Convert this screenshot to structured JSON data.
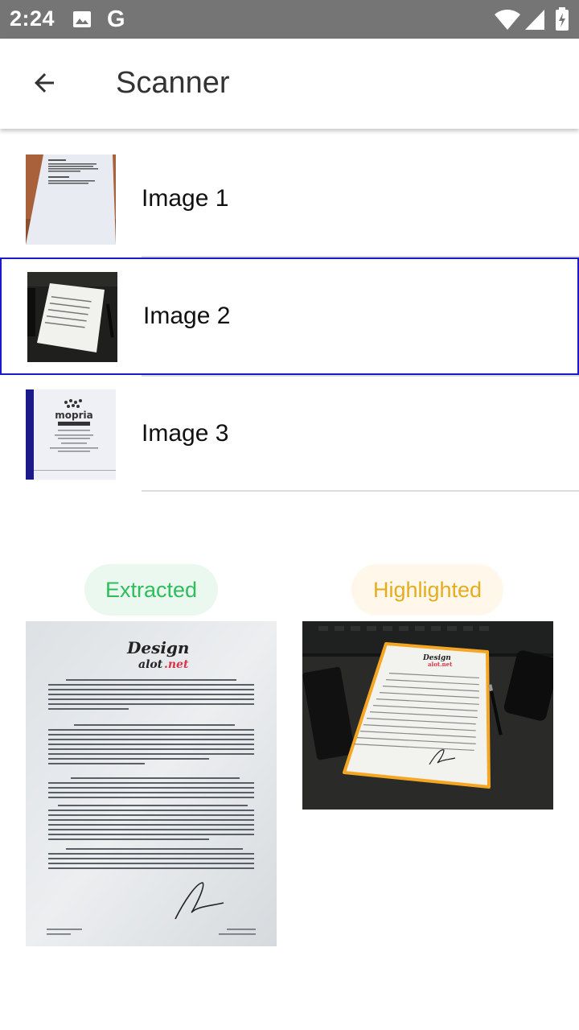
{
  "status_bar": {
    "time": "2:24",
    "icons": [
      "image-icon",
      "google-g-icon",
      "wifi-icon",
      "signal-icon",
      "battery-charging-icon"
    ],
    "g_letter": "G"
  },
  "app_bar": {
    "back_icon": "arrow-back-icon",
    "title": "Scanner"
  },
  "list": {
    "items": [
      {
        "label": "Image 1",
        "thumbnail": "document-on-wood-table",
        "selected": false
      },
      {
        "label": "Image 2",
        "thumbnail": "document-on-dark-desk",
        "selected": true
      },
      {
        "label": "Image 3",
        "thumbnail": "mopria-document-on-blue"
      }
    ]
  },
  "results": {
    "extracted_label": "Extracted",
    "highlighted_label": "Highlighted",
    "extracted_image": "flattened-letter-scan",
    "highlighted_image": "document-with-orange-outline",
    "colors": {
      "extracted_text": "#2ebd5b",
      "extracted_bg": "#ebf8ef",
      "highlighted_text": "#e5ad1e",
      "highlighted_bg": "#fff8ea",
      "highlight_outline": "#f5a623",
      "selected_border": "#1a1ac8"
    }
  }
}
